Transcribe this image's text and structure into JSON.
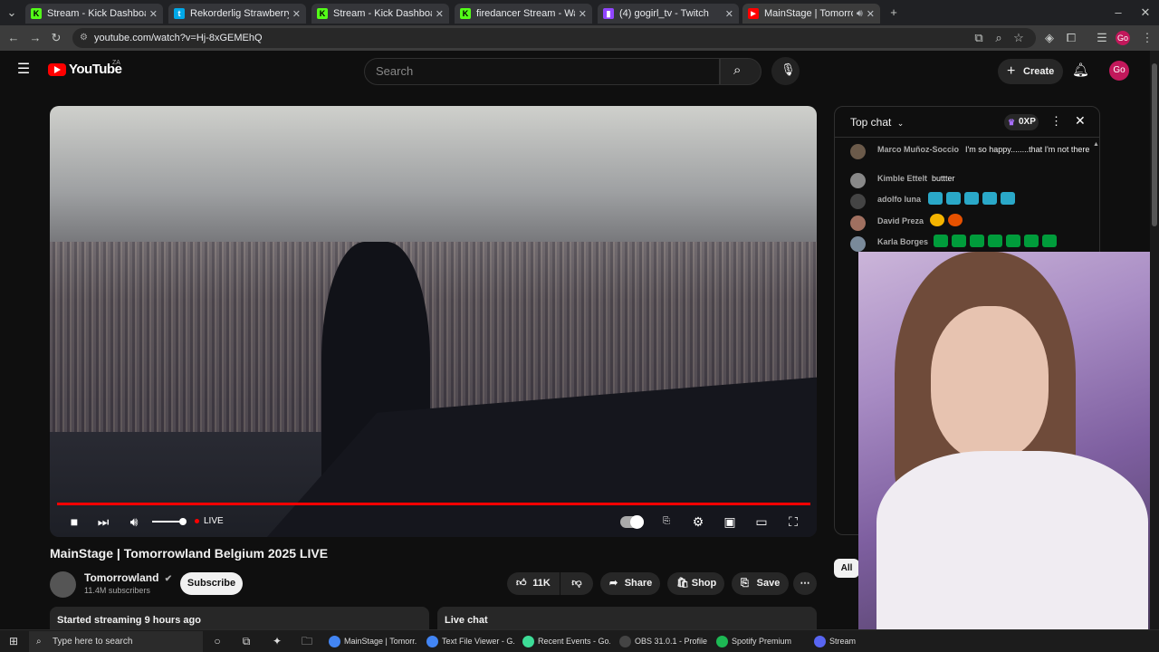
{
  "browser": {
    "tabs": [
      {
        "label": "Stream - Kick Dashboard",
        "favicon": "kick-icon",
        "color": "#53fc18"
      },
      {
        "label": "Rekorderlig Strawberry-Lime -",
        "favicon": "tumblr-icon",
        "color": "#00a8e8"
      },
      {
        "label": "Stream - Kick Dashboard",
        "favicon": "kick-icon",
        "color": "#53fc18"
      },
      {
        "label": "firedancer Stream - Watch Live",
        "favicon": "kick-icon",
        "color": "#53fc18"
      },
      {
        "label": "(4) gogirl_tv - Twitch",
        "favicon": "twitch-icon",
        "color": "#9146ff"
      },
      {
        "label": "MainStage | Tomorrowland",
        "favicon": "youtube-icon",
        "color": "#ff0000"
      }
    ],
    "url": "youtube.com/watch?v=Hj-8xGEMEhQ",
    "profile_initials": "Go"
  },
  "youtube": {
    "logo": "YouTube",
    "region": "ZA",
    "search_placeholder": "Search",
    "create_label": "Create",
    "avatar_initials": "Go"
  },
  "player": {
    "live_label": "LIVE",
    "progress": 1.0
  },
  "video": {
    "title": "MainStage | Tomorrowland Belgium 2025 LIVE",
    "channel": "Tomorrowland",
    "subscribers": "11.4M subscribers",
    "subscribe_label": "Subscribe",
    "likes": "11K",
    "share_label": "Share",
    "shop_label": "Shop",
    "save_label": "Save",
    "stream_info": "Started streaming 9 hours ago",
    "live_chat_label": "Live chat"
  },
  "chat": {
    "title": "Top chat",
    "xp": "0XP",
    "all_chip": "All",
    "messages": [
      {
        "author": "Marco Muñoz-Soccio",
        "text": "I'm so happy........that I'm not there"
      },
      {
        "author": "Kimble Ettelt",
        "text": "buttter"
      },
      {
        "author": "adolfo luna",
        "text": ""
      },
      {
        "author": "David Preza",
        "text": ""
      },
      {
        "author": "Karla Borges",
        "text": ""
      }
    ]
  },
  "taskbar": {
    "search_placeholder": "Type here to search",
    "apps": [
      {
        "label": "MainStage | Tomorr...",
        "color": "#4285f4"
      },
      {
        "label": "Text File Viewer - G...",
        "color": "#4285f4"
      },
      {
        "label": "Recent Events - Go...",
        "color": "#3ddc97"
      },
      {
        "label": "OBS 31.0.1 - Profile:...",
        "color": "#444444"
      },
      {
        "label": "Spotify Premium",
        "color": "#1db954"
      },
      {
        "label": "Stream D",
        "color": "#5865f2"
      }
    ]
  }
}
